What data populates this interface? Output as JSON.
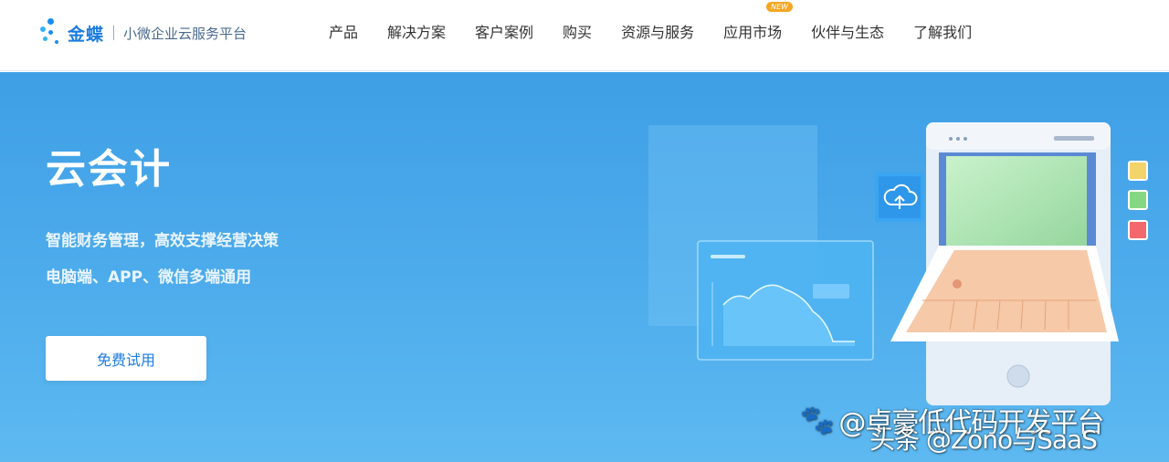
{
  "brand": {
    "name": "金蝶",
    "subtitle": "小微企业云服务平台",
    "color": "#1a7be0"
  },
  "nav": {
    "items": [
      {
        "label": "产品"
      },
      {
        "label": "解决方案"
      },
      {
        "label": "客户案例"
      },
      {
        "label": "购买"
      },
      {
        "label": "资源与服务"
      },
      {
        "label": "应用市场",
        "badge": "NEW"
      },
      {
        "label": "伙伴与生态"
      },
      {
        "label": "了解我们"
      }
    ]
  },
  "hero": {
    "title": "云会计",
    "line1": "智能财务管理，高效支撑经营决策",
    "line2": "电脑端、APP、微信多端通用",
    "cta": "免费试用",
    "background_top": "#3f9fe6",
    "background_bottom": "#5eb9f1"
  },
  "watermark": {
    "line1": "@卓豪低代码开发平台",
    "line2": "头条 @Zono与SaaS"
  }
}
